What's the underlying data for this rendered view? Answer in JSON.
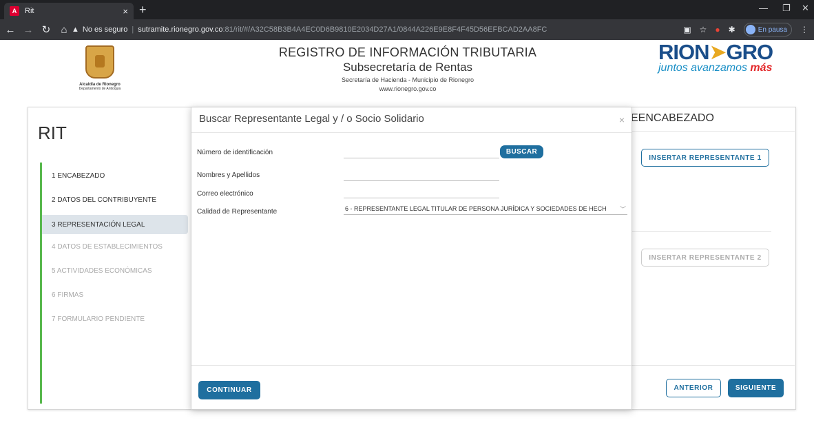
{
  "browser": {
    "tab_title": "Rit",
    "tab_favicon_letter": "A",
    "new_tab": "+",
    "close_tab": "×",
    "security_label": "No es seguro",
    "url_host": "sutramite.rionegro.gov.co",
    "url_path": ":81/rit/#/A32C58B3B4A4EC0D6B9810E2034D27A1/0844A226E9E8F4F45D56EFBCAD2AA8FC",
    "profile_status": "En pausa",
    "nav_icons": [
      "arrow-left-icon",
      "arrow-right-icon",
      "reload-icon",
      "home-icon"
    ],
    "toolbar_icons": [
      "translate-icon",
      "star-icon",
      "extension-red-icon",
      "puzzle-icon"
    ]
  },
  "header": {
    "left_logo_name": "Alcaldía de Rionegro",
    "left_logo_sub": "Departamento de Antioquia",
    "title": "REGISTRO DE INFORMACIÓN TRIBUTARIA",
    "subtitle": "Subsecretaría de Rentas",
    "line": "Secretaría de Hacienda - Municipio de Rionegro",
    "website": "www.rionegro.gov.co",
    "brand_left": "RION",
    "brand_right": "GRO",
    "brand_tagline": "juntos avanzamos",
    "brand_tagline_emph": "más"
  },
  "page": {
    "title": "RIT",
    "steps": [
      "1 ENCABEZADO",
      "2 DATOS DEL CONTRIBUYENTE",
      "3 REPRESENTACIÓN LEGAL",
      "4 DATOS DE ESTABLECIMIENTOS",
      "5 ACTIVIDADES ECONÓMICAS",
      "6 FIRMAS",
      "7  FORMULARIO PENDIENTE"
    ],
    "section_title": "EENCABEZADO",
    "insert_rep_1": "INSERTAR REPRESENTANTE 1",
    "insert_rep_2": "INSERTAR REPRESENTANTE 2",
    "prev_label": "ANTERIOR",
    "next_label": "SIGUIENTE"
  },
  "modal": {
    "title": "Buscar Representante Legal y / o Socio Solidario",
    "close": "×",
    "id_label": "Número de identificación",
    "search_label": "BUSCAR",
    "names_label": "Nombres y Apellidos",
    "email_label": "Correo electrónico",
    "quality_label": "Calidad de Representante",
    "quality_value": "6 - REPRESENTANTE LEGAL TITULAR DE PERSONA JURÍDICA Y SOCIEDADES DE HECH",
    "continue_label": "CONTINUAR"
  },
  "colors": {
    "primary": "#1f6f9f",
    "active_step_bg": "#dde4ea",
    "progress_bar": "#58b84d"
  }
}
